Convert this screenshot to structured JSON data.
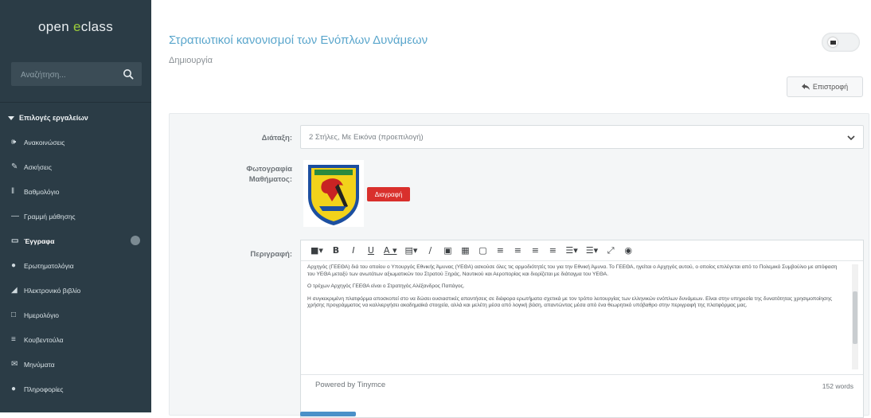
{
  "sidebar": {
    "logo_prefix": "open ",
    "logo_accent": "e",
    "logo_suffix": "class",
    "search_placeholder": "Αναζήτηση...",
    "section_title": "Επιλογές εργαλείων",
    "items": [
      {
        "icon": "megaphone-icon",
        "label": "Ανακοινώσεις"
      },
      {
        "icon": "edit-icon",
        "label": "Ασκήσεις"
      },
      {
        "icon": "grades-icon",
        "label": "Βαθμολόγιο"
      },
      {
        "icon": "minus-icon",
        "label": "Γραμμή μάθησης"
      },
      {
        "icon": "folder-icon",
        "label": "Έγγραφα",
        "active": true
      },
      {
        "icon": "question-icon",
        "label": "Ερωτηματολόγια"
      },
      {
        "icon": "book-icon",
        "label": "Ηλεκτρονικό βιβλίο"
      },
      {
        "icon": "calendar-icon",
        "label": "Ημερολόγιο"
      },
      {
        "icon": "chat-icon",
        "label": "Κουβεντούλα"
      },
      {
        "icon": "message-icon",
        "label": "Μηνύματα"
      },
      {
        "icon": "info-icon",
        "label": "Πληροφορίες"
      }
    ]
  },
  "header": {
    "title": "Στρατιωτικοί κανονισμοί των Ενόπλων Δυνάμεων",
    "breadcrumb": "Δημιουργία",
    "back_label": "Επιστροφή"
  },
  "form": {
    "layout_label": "Διάταξη:",
    "layout_value": "2 Στήλες, Με Εικόνα (προεπιλογή)",
    "photo_label_1": "Φωτογραφία",
    "photo_label_2": "Μαθήματος:",
    "delete_label": "Διαγραφή",
    "description_label": "Περιγραφή:"
  },
  "editor": {
    "paragraph_1": "Αρχηγός (ΓΕΕΘΑ) διά του οποίου ο Υπουργός Εθνικής Άμυνας (ΥΕΘΑ) ασκούσε όλες τις αρμοδιότητές του για την Εθνική Άμυνα. Το ΓΕΕΘΑ, ηγείται ο Αρχηγός αυτού, ο οποίος επιλέγεται από το Πολεμικό Συμβούλιο με απόφαση του ΥΕΘΑ μεταξύ των ανωτάτων αξιωματικών του Στρατού Ξηράς, Ναυτικού και Αεροπορίας και διορίζεται με διάταγμα του ΥΕΘΑ.",
    "paragraph_2": "Ο τρέχων Αρχηγός ΓΕΕΘΑ είναι ο Στρατηγός Αλέξανδρος Παπάγος.",
    "paragraph_3": "Η συγκεκριμένη πλατφόρμα αποσκοπεί στο να δώσει ουσιαστικές απαντήσεις σε διάφορα ερωτήματα σχετικά με τον τρόπο λειτουργίας των ελληνικών ενόπλων δυνάμεων. Είναι στην υπηρεσία της δυνατότητας χρησιμοποίησης χρήσης προγράμματος να καλλιεργήσει ακαδημαϊκά στοιχεία, αλλά και μελέτη μέσα από λογική βάση, απαντώντας μέσα από ένα θεωρητικό υπόβαθρο στην περιγραφή της πλατφόρμας μας.",
    "powered_by": "Powered by Tinymce",
    "word_count": "152 words"
  },
  "colors": {
    "sidebar_bg": "#2b3c46",
    "accent": "#9ccc3a",
    "title": "#5aa6cc",
    "danger": "#d9302c"
  }
}
